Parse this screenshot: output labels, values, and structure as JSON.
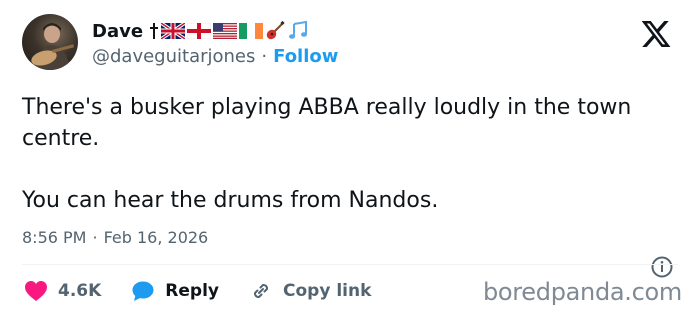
{
  "author": {
    "display_name": "Dave",
    "name_emojis": [
      "dagger",
      "union-jack-flag",
      "england-flag",
      "us-flag",
      "ireland-flag",
      "guitar",
      "music-notes"
    ],
    "handle": "@daveguitarjones",
    "separator": "·",
    "follow_label": "Follow"
  },
  "tweet": {
    "paragraph_1": "There's a busker playing ABBA really loudly in the town centre.",
    "paragraph_2": "You can hear the drums from Nandos."
  },
  "meta": {
    "time": "8:56 PM",
    "separator": "·",
    "date": "Feb 16, 2026"
  },
  "actions": {
    "likes": "4.6K",
    "reply_label": "Reply",
    "copy_label": "Copy link"
  },
  "watermark": "boredpanda.com",
  "colors": {
    "like": "#f91880",
    "reply": "#1d9bf0",
    "follow": "#1d9bf0",
    "secondary_text": "#536471"
  }
}
